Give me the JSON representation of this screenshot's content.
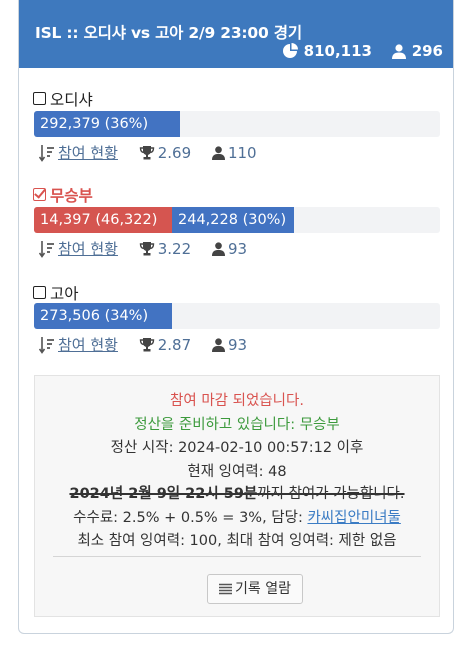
{
  "header": {
    "title": "ISL :: 오디샤 vs 고아 2/9 23:00 경기",
    "total_points": "810,113",
    "participants": "296"
  },
  "options": [
    {
      "name": "오디샤",
      "checked": false,
      "bar_text": "292,379 (36%)",
      "bar_fraction": 0.36,
      "participation_link": "참여 현황",
      "odds": "2.69",
      "people": "110"
    },
    {
      "name": "무승부",
      "checked": true,
      "bar_text_red": "14,397 (46,322)",
      "bar_text": "244,228 (30%)",
      "bar_fraction": 0.3,
      "participation_link": "참여 현황",
      "odds": "3.22",
      "people": "93"
    },
    {
      "name": "고아",
      "checked": false,
      "bar_text": "273,506 (34%)",
      "bar_fraction": 0.34,
      "participation_link": "참여 현황",
      "odds": "2.87",
      "people": "93"
    }
  ],
  "info": {
    "closed": "참여 마감 되었습니다.",
    "settling": "정산을 준비하고 있습니다: 무승부",
    "settle_start": "정산 시작: 2024-02-10 00:57:12 이후",
    "current_surplus": "현재 잉여력: 48",
    "deadline_struck": "2024년 2월 9일 22시 59분",
    "deadline_suffix": "까지 참여가 가능합니다.",
    "fee_prefix": "수수료: 2.5% + 0.5% = 3%, 담당: ",
    "manager": "카씨집안미녀둘",
    "limits": "최소 참여 잉여력: 100, 최대 참여 잉여력: 제한 없음",
    "records_button": "기록 열람"
  },
  "colors": {
    "header_bg": "#3e79be",
    "bar_blue": "#4273c2",
    "bar_red": "#d55550",
    "win_red": "#d9534f",
    "settle_green": "#3c9a3c"
  }
}
